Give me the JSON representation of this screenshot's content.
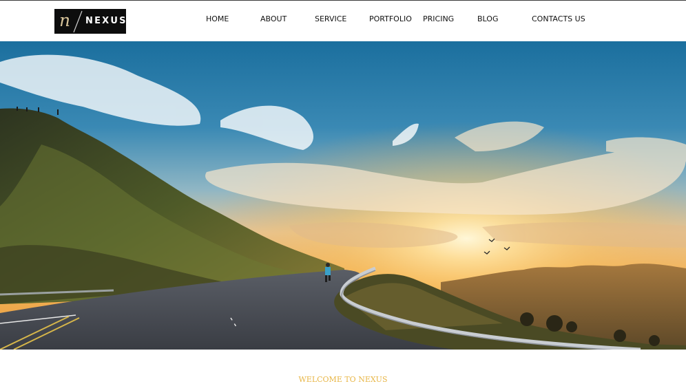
{
  "header": {
    "logo": {
      "mark": "n",
      "name": "NEXUS"
    },
    "nav": [
      {
        "label": "HOME"
      },
      {
        "label": "ABOUT"
      },
      {
        "label": "SERVICE"
      },
      {
        "label": "PORTFOLIO"
      },
      {
        "label": "PRICING"
      },
      {
        "label": "BLOG"
      },
      {
        "label": "CONTACTS US"
      }
    ]
  },
  "hero": {
    "image": "sunset-mountain-road"
  },
  "welcome": {
    "text": "WELCOME TO NEXUS"
  },
  "colors": {
    "accent": "#e8b646",
    "logo_background": "#0d0d0d",
    "logo_mark": "#d8c49a"
  }
}
